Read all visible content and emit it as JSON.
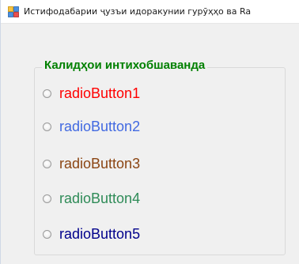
{
  "window": {
    "title": "Истифодабарии ҷузъи идоракунии гурӯҳҳо ва Ra",
    "icon": "winforms-app-icon"
  },
  "groupbox": {
    "title": "Калидҳои интихобшаванда",
    "title_color": "#008000"
  },
  "radio_buttons": [
    {
      "label": "radioButton1",
      "color": "#ff0000",
      "checked": false
    },
    {
      "label": "radioButton2",
      "color": "#4169e1",
      "checked": false
    },
    {
      "label": "radioButton3",
      "color": "#8b4513",
      "checked": false
    },
    {
      "label": "radioButton4",
      "color": "#2e8b57",
      "checked": false
    },
    {
      "label": "radioButton5",
      "color": "#00008b",
      "checked": false
    }
  ]
}
